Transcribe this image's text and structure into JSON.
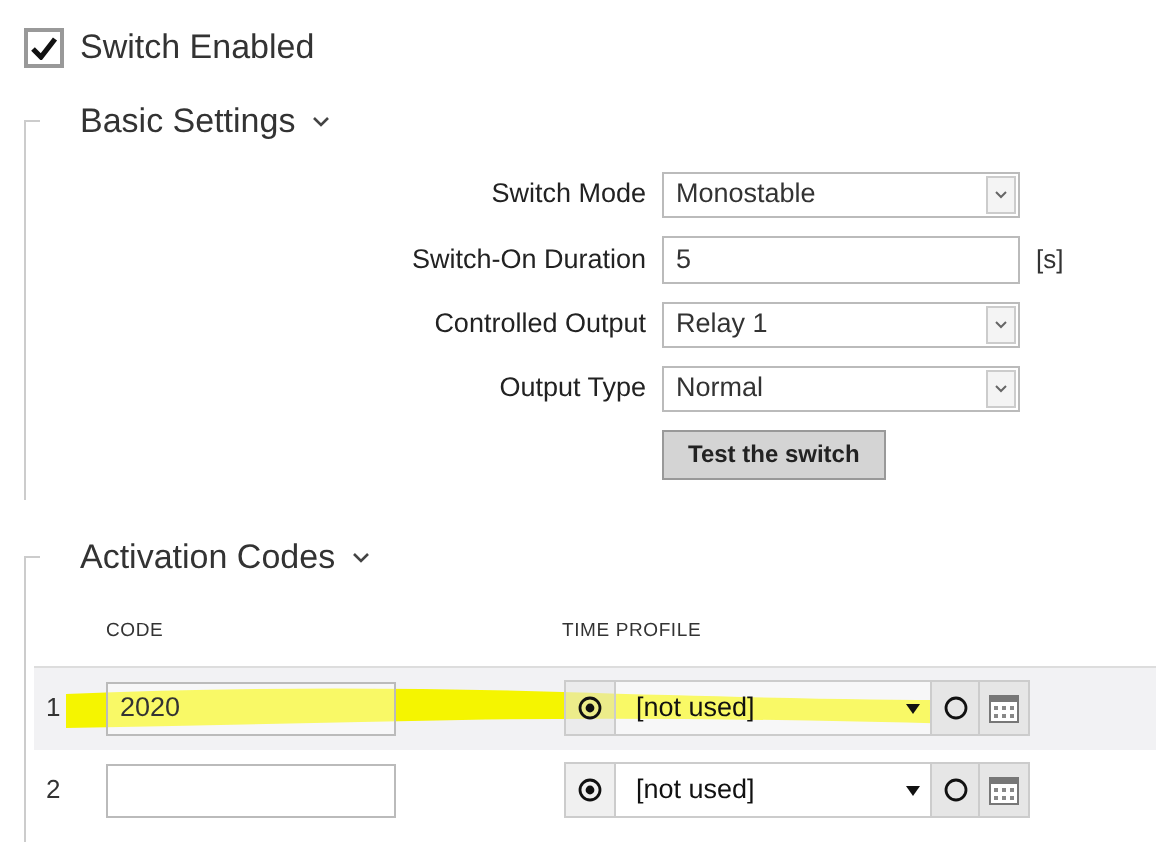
{
  "switch_enabled": {
    "label": "Switch Enabled",
    "checked": true
  },
  "basic_settings": {
    "title": "Basic Settings",
    "expanded": true,
    "fields": [
      {
        "kind": "select",
        "label": "Switch Mode",
        "value": "Monostable"
      },
      {
        "kind": "text",
        "label": "Switch-On Duration",
        "value": "5",
        "unit": "[s]"
      },
      {
        "kind": "select",
        "label": "Controlled Output",
        "value": "Relay 1"
      },
      {
        "kind": "select",
        "label": "Output Type",
        "value": "Normal"
      }
    ],
    "test_button": "Test the switch"
  },
  "activation_codes": {
    "title": "Activation Codes",
    "expanded": true,
    "columns": [
      "CODE",
      "TIME PROFILE"
    ],
    "rows": [
      {
        "index": "1",
        "code": "2020",
        "profile": "[not used]",
        "profile_on": true,
        "hovered": true,
        "marked": true
      },
      {
        "index": "2",
        "code": "",
        "profile": "[not used]",
        "profile_on": true,
        "hovered": false,
        "marked": false
      }
    ]
  }
}
